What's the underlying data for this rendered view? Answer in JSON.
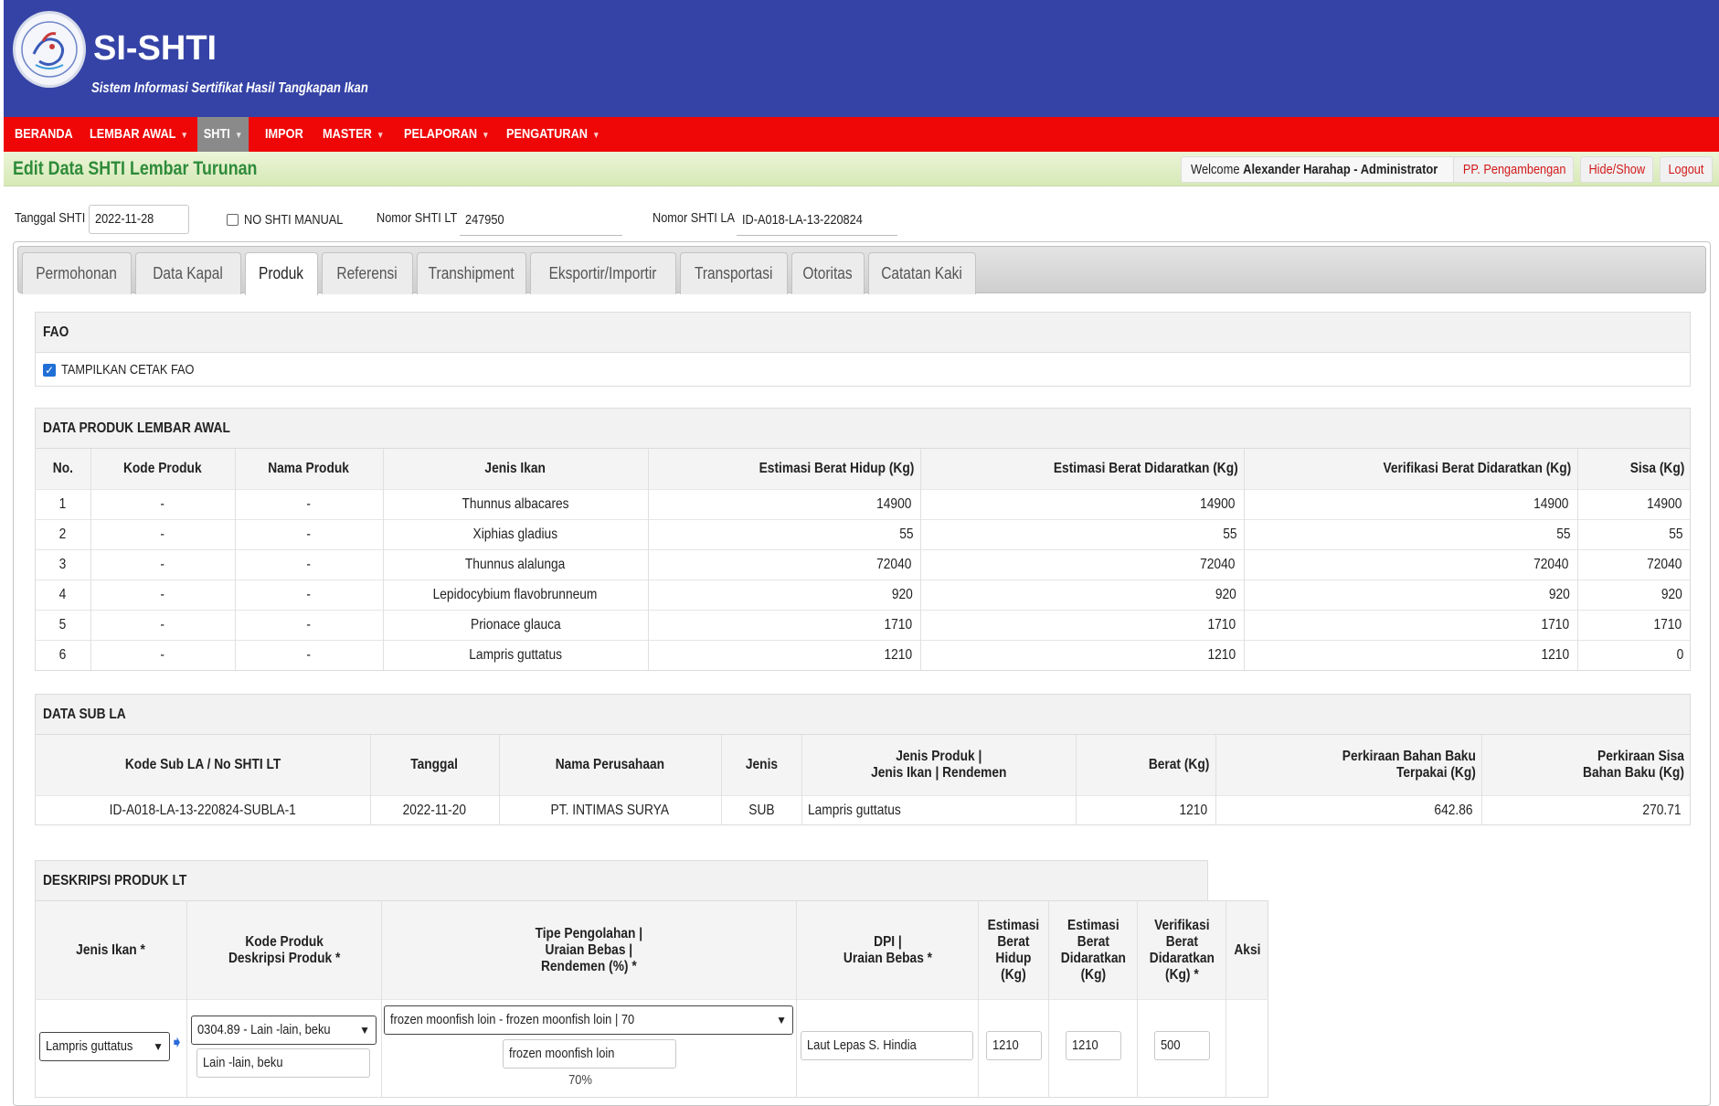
{
  "app": {
    "title": "SI-SHTI",
    "subtitle": "Sistem Informasi Sertifikat Hasil Tangkapan Ikan"
  },
  "nav": [
    {
      "label": "BERANDA",
      "dropdown": false
    },
    {
      "label": "LEMBAR AWAL",
      "dropdown": true
    },
    {
      "label": "SHTI",
      "dropdown": true,
      "active": true
    },
    {
      "label": "IMPOR",
      "dropdown": false
    },
    {
      "label": "MASTER",
      "dropdown": true
    },
    {
      "label": "PELAPORAN",
      "dropdown": true
    },
    {
      "label": "PENGATURAN",
      "dropdown": true
    }
  ],
  "page": {
    "title": "Edit Data SHTI Lembar Turunan",
    "welcome_prefix": "Welcome",
    "user": "Alexander Harahap - Administrator",
    "buttons": {
      "unit": "PP. Pengambengan",
      "hide_show": "Hide/Show",
      "logout": "Logout"
    }
  },
  "form": {
    "tanggal_label": "Tanggal SHTI",
    "tanggal_value": "2022-11-28",
    "manual_label": "NO SHTI MANUAL",
    "nomor_lt_label": "Nomor SHTI LT",
    "nomor_lt_value": "247950",
    "nomor_la_label": "Nomor SHTI LA",
    "nomor_la_value": "ID-A018-LA-13-220824"
  },
  "tabs": [
    "Permohonan",
    "Data Kapal",
    "Produk",
    "Referensi",
    "Transhipment",
    "Eksportir/Importir",
    "Transportasi",
    "Otoritas",
    "Catatan Kaki"
  ],
  "active_tab": "Produk",
  "fao": {
    "title": "FAO",
    "checkbox_label": "TAMPILKAN CETAK FAO",
    "checked": true
  },
  "produk_awal": {
    "title": "DATA PRODUK LEMBAR AWAL",
    "columns": [
      "No.",
      "Kode Produk",
      "Nama Produk",
      "Jenis Ikan",
      "Estimasi Berat Hidup (Kg)",
      "Estimasi Berat Didaratkan (Kg)",
      "Verifikasi Berat Didaratkan (Kg)",
      "Sisa (Kg)"
    ],
    "rows": [
      [
        "1",
        "-",
        "-",
        "Thunnus albacares",
        "14900",
        "14900",
        "14900",
        "14900"
      ],
      [
        "2",
        "-",
        "-",
        "Xiphias gladius",
        "55",
        "55",
        "55",
        "55"
      ],
      [
        "3",
        "-",
        "-",
        "Thunnus alalunga",
        "72040",
        "72040",
        "72040",
        "72040"
      ],
      [
        "4",
        "-",
        "-",
        "Lepidocybium flavobrunneum",
        "920",
        "920",
        "920",
        "920"
      ],
      [
        "5",
        "-",
        "-",
        "Prionace glauca",
        "1710",
        "1710",
        "1710",
        "1710"
      ],
      [
        "6",
        "-",
        "-",
        "Lampris guttatus",
        "1210",
        "1210",
        "1210",
        "0"
      ]
    ]
  },
  "sub_la": {
    "title": "DATA SUB LA",
    "columns": [
      [
        "Kode Sub LA / No SHTI LT"
      ],
      [
        "Tanggal"
      ],
      [
        "Nama Perusahaan"
      ],
      [
        "Jenis"
      ],
      [
        "Jenis Produk |",
        "Jenis Ikan | Rendemen"
      ],
      [
        "Berat (Kg)"
      ],
      [
        "Perkiraan Bahan Baku",
        "Terpakai (Kg)"
      ],
      [
        "Perkiraan Sisa",
        "Bahan Baku (Kg)"
      ]
    ],
    "rows": [
      [
        "ID-A018-LA-13-220824-SUBLA-1",
        "2022-11-20",
        "PT. INTIMAS SURYA",
        "SUB",
        "Lampris guttatus",
        "1210",
        "642.86",
        "270.71"
      ]
    ]
  },
  "deskripsi": {
    "title": "DESKRIPSI PRODUK LT",
    "columns": [
      [
        "Jenis Ikan *"
      ],
      [
        "Kode Produk",
        "Deskripsi Produk *"
      ],
      [
        "Tipe Pengolahan |",
        "Uraian Bebas |",
        "Rendemen (%) *"
      ],
      [
        "DPI |",
        "Uraian Bebas *"
      ],
      [
        "Estimasi",
        "Berat",
        "Hidup",
        "(Kg)"
      ],
      [
        "Estimasi",
        "Berat",
        "Didaratkan",
        "(Kg)"
      ],
      [
        "Verifikasi",
        "Berat",
        "Didaratkan",
        "(Kg) *"
      ],
      [
        "Aksi"
      ]
    ],
    "row": {
      "jenis_ikan": "Lampris guttatus",
      "kode_produk": "0304.89 - Lain -lain, beku",
      "deskripsi_produk": "Lain -lain, beku",
      "tipe_pengolahan": "frozen moonfish loin - frozen moonfish loin | 70",
      "uraian_bebas": "frozen moonfish loin",
      "rendemen": "70%",
      "dpi": "Laut Lepas S. Hindia",
      "estimasi_hidup": "1210",
      "estimasi_didaratkan": "1210",
      "verifikasi": "500"
    }
  }
}
